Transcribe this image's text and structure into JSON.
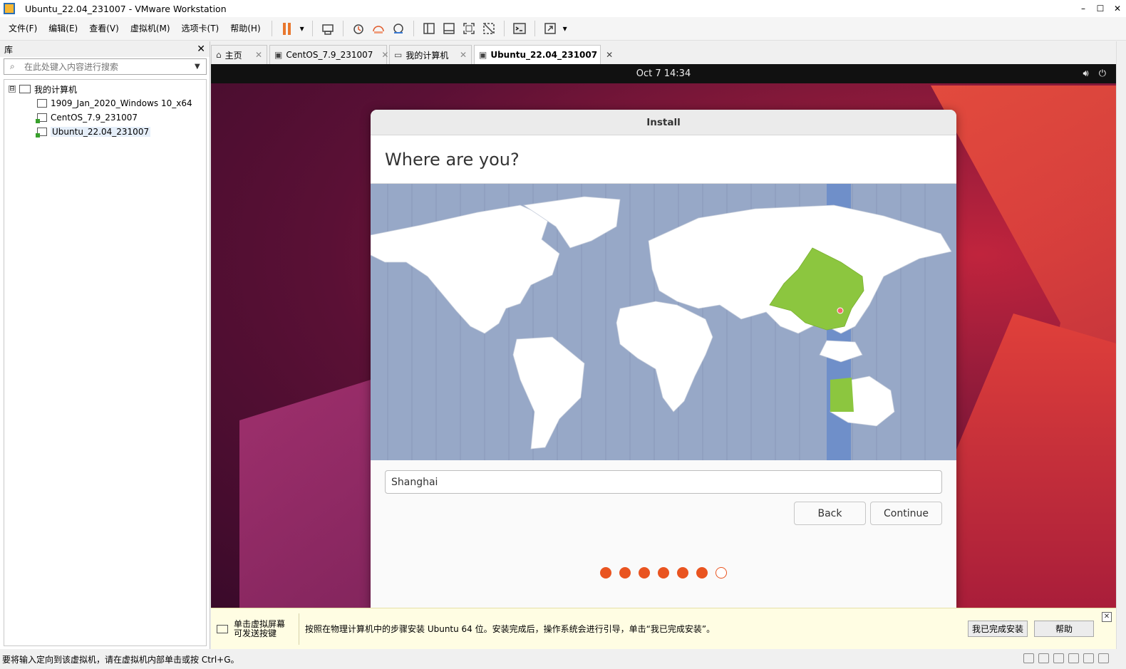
{
  "window": {
    "title": "Ubuntu_22.04_231007 - VMware Workstation",
    "min": "–",
    "max": "☐",
    "close": "✕"
  },
  "menu": [
    "文件(F)",
    "编辑(E)",
    "查看(V)",
    "虚拟机(M)",
    "选项卡(T)",
    "帮助(H)"
  ],
  "library": {
    "title": "库",
    "close": "✕",
    "search_placeholder": "在此处键入内容进行搜索",
    "root": "我的计算机",
    "expander": "⊟",
    "items": [
      "1909_Jan_2020_Windows 10_x64",
      "CentOS_7.9_231007",
      "Ubuntu_22.04_231007"
    ]
  },
  "tabs": [
    {
      "label": "主页"
    },
    {
      "label": "CentOS_7.9_231007"
    },
    {
      "label": "我的计算机"
    },
    {
      "label": "Ubuntu_22.04_231007"
    }
  ],
  "tab_close": "✕",
  "guest": {
    "clock": "Oct 7  14:34",
    "installer": {
      "window_title": "Install",
      "heading": "Where are you?",
      "location_value": "Shanghai",
      "back_label": "Back",
      "continue_label": "Continue",
      "progress": {
        "total_steps": 7,
        "completed_steps": 6
      }
    }
  },
  "hint": {
    "left_line1": "单击虚拟屏幕",
    "left_line2": "可发送按键",
    "message": "按照在物理计算机中的步骤安装 Ubuntu 64 位。安装完成后，操作系统会进行引导，单击“我已完成安装”。",
    "done_button": "我已完成安装",
    "help_button": "帮助",
    "close": "✕"
  },
  "status": {
    "text": "要将输入定向到该虚拟机，请在虚拟机内部单击或按 Ctrl+G。"
  },
  "colors": {
    "accent": "#e95420",
    "map_ocean": "#97a8c7",
    "map_selected": "#8cc63f",
    "timezone_band": "#6f8fc9"
  }
}
